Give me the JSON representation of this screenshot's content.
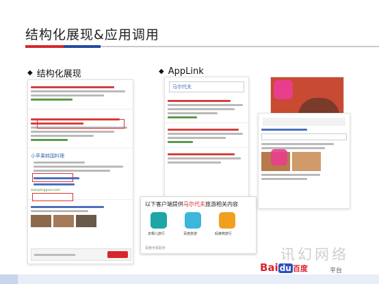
{
  "slide": {
    "title": "结构化展现&应用调用",
    "left_heading": "结构化展现",
    "right_heading": "AppLink",
    "bullet": "◆"
  },
  "left_phone": {
    "card3_title": "小苹果韩国料理",
    "card3_url": "xiaopingguo.com"
  },
  "mid_phone": {
    "search_text": "马尔代夫"
  },
  "popup": {
    "title_prefix": "以下客户端提供",
    "title_keyword": "马尔代夫",
    "title_suffix": "旅游相关内容",
    "apps": [
      "去哪儿旅行",
      "百度旅游",
      "蚂蜂窝旅行"
    ],
    "footer": "百度手机助手"
  },
  "branding": {
    "logo_text": "Bai",
    "logo_du": "du",
    "logo_suffix": "百度",
    "watermark": "讯幻网络",
    "watermark_sub": "平台"
  },
  "colors": {
    "red": "#d9262c",
    "blue": "#1f4aa0",
    "pink": "#e83e8c",
    "link_blue": "#3b6cb5"
  }
}
